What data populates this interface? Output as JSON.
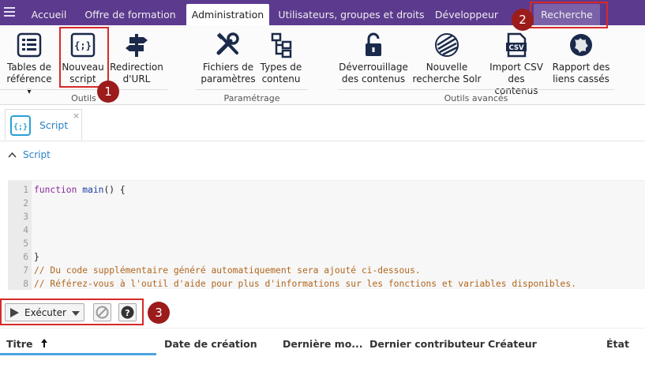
{
  "nav": {
    "tabs": [
      {
        "label": "Accueil"
      },
      {
        "label": "Offre de formation"
      },
      {
        "label": "Administration"
      },
      {
        "label": "Utilisateurs, groupes et droits"
      },
      {
        "label": "Développeur"
      },
      {
        "label": "Recherche"
      }
    ]
  },
  "ribbon": {
    "buttons": [
      {
        "label1": "Tables de",
        "label2": "référence ▾"
      },
      {
        "label1": "Nouveau",
        "label2": "script"
      },
      {
        "label1": "Redirection",
        "label2": "d'URL"
      },
      {
        "label1": "Fichiers de",
        "label2": "paramètres"
      },
      {
        "label1": "Types de",
        "label2": "contenu"
      },
      {
        "label1": "Déverrouillage",
        "label2": "des contenus"
      },
      {
        "label1": "Nouvelle",
        "label2": "recherche Solr"
      },
      {
        "label1": "Import CSV",
        "label2": "des contenus"
      },
      {
        "label1": "Rapport des",
        "label2": "liens cassés"
      }
    ],
    "groups": [
      {
        "label": "Outils"
      },
      {
        "label": "Paramétrage"
      },
      {
        "label": "Outils avancés"
      }
    ],
    "csv_icon_text": "CSV"
  },
  "callouts": [
    "1",
    "2",
    "3"
  ],
  "doc_tab": {
    "label": "Script",
    "close": "×",
    "icon_text": "{;}"
  },
  "section": {
    "title": "Script"
  },
  "editor": {
    "lines": [
      {
        "num": "1",
        "kw": "function",
        "fn": " main",
        "rest": "() {",
        "comment": ""
      },
      {
        "num": "2",
        "kw": "",
        "fn": "",
        "rest": "",
        "comment": ""
      },
      {
        "num": "3",
        "kw": "",
        "fn": "",
        "rest": "",
        "comment": ""
      },
      {
        "num": "4",
        "kw": "",
        "fn": "",
        "rest": "",
        "comment": ""
      },
      {
        "num": "5",
        "kw": "",
        "fn": "",
        "rest": "",
        "comment": ""
      },
      {
        "num": "6",
        "kw": "",
        "fn": "",
        "rest": "}",
        "comment": ""
      },
      {
        "num": "7",
        "kw": "",
        "fn": "",
        "rest": "",
        "comment": "// Du code supplémentaire généré automatiquement sera ajouté ci-dessous."
      },
      {
        "num": "8",
        "kw": "",
        "fn": "",
        "rest": "",
        "comment": "// Référez-vous à l'outil d'aide pour plus d'informations sur les fonctions et variables disponibles."
      }
    ]
  },
  "toolbar": {
    "execute_label": "Exécuter",
    "help_glyph": "?"
  },
  "table": {
    "columns": [
      {
        "label": "Titre"
      },
      {
        "label": "Date de création"
      },
      {
        "label": "Dernière mo..."
      },
      {
        "label": "Dernier contributeur"
      },
      {
        "label": "Créateur"
      },
      {
        "label": "État"
      }
    ],
    "sort_glyph": "🠕"
  },
  "colors": {
    "brand": "#5c3a8e",
    "accent": "#2a82c4",
    "callout": "#d62a2a"
  }
}
